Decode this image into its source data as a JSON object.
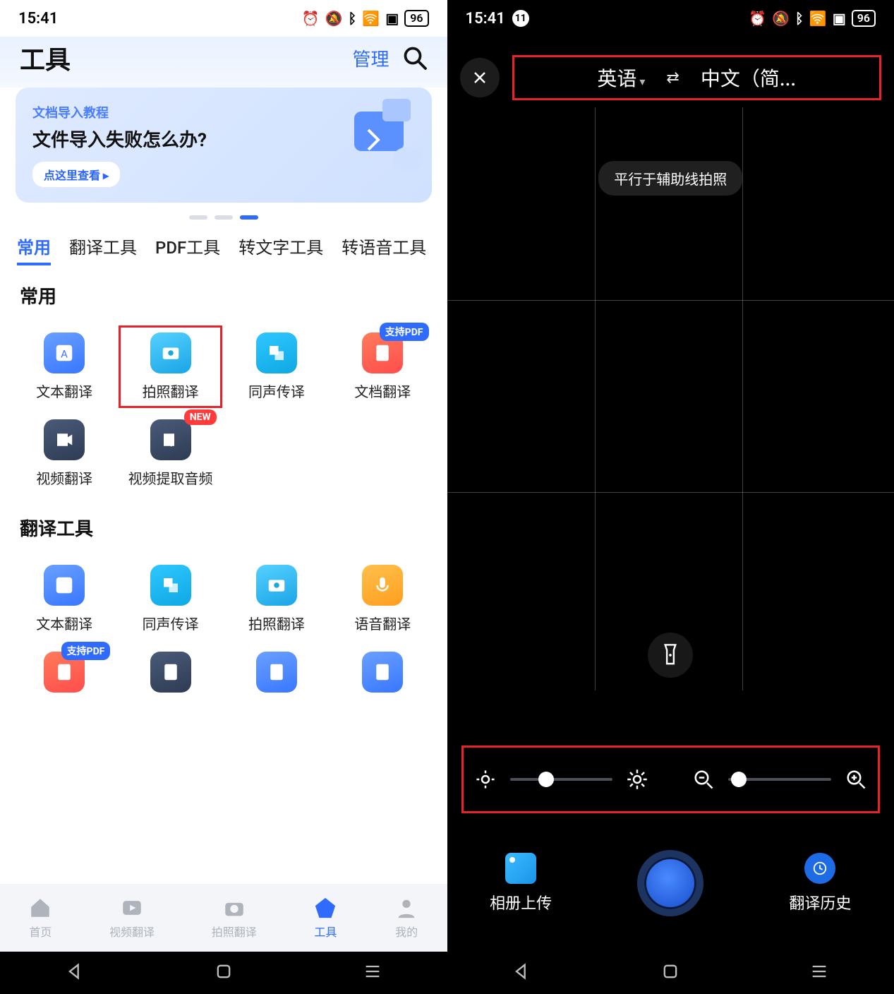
{
  "statusbar": {
    "time": "15:41",
    "battery": "96",
    "notif_count": "11"
  },
  "left": {
    "title": "工具",
    "manage": "管理",
    "banner": {
      "sub": "文档导入教程",
      "title": "文件导入失败怎么办?",
      "btn": "点这里查看 ▸"
    },
    "tabs": [
      "常用",
      "翻译工具",
      "PDF工具",
      "转文字工具",
      "转语音工具"
    ],
    "section1": {
      "title": "常用",
      "items": [
        {
          "label": "文本翻译"
        },
        {
          "label": "拍照翻译",
          "highlight": true
        },
        {
          "label": "同声传译"
        },
        {
          "label": "文档翻译",
          "badge": "支持PDF"
        },
        {
          "label": "视频翻译"
        },
        {
          "label": "视频提取音频",
          "badge": "NEW",
          "badgeColor": "red"
        }
      ]
    },
    "section2": {
      "title": "翻译工具",
      "items": [
        {
          "label": "文本翻译"
        },
        {
          "label": "同声传译"
        },
        {
          "label": "拍照翻译"
        },
        {
          "label": "语音翻译"
        },
        {
          "label": "",
          "badge": "支持PDF"
        }
      ]
    },
    "bottombar": [
      {
        "label": "首页"
      },
      {
        "label": "视频翻译"
      },
      {
        "label": "拍照翻译"
      },
      {
        "label": "工具",
        "active": true
      },
      {
        "label": "我的"
      }
    ]
  },
  "right": {
    "lang_src": "英语",
    "lang_dst": "中文（简...",
    "tip": "平行于辅助线拍照",
    "brightness_pos": 0.35,
    "zoom_pos": 0.1,
    "actions": {
      "album": "相册上传",
      "history": "翻译历史"
    }
  }
}
